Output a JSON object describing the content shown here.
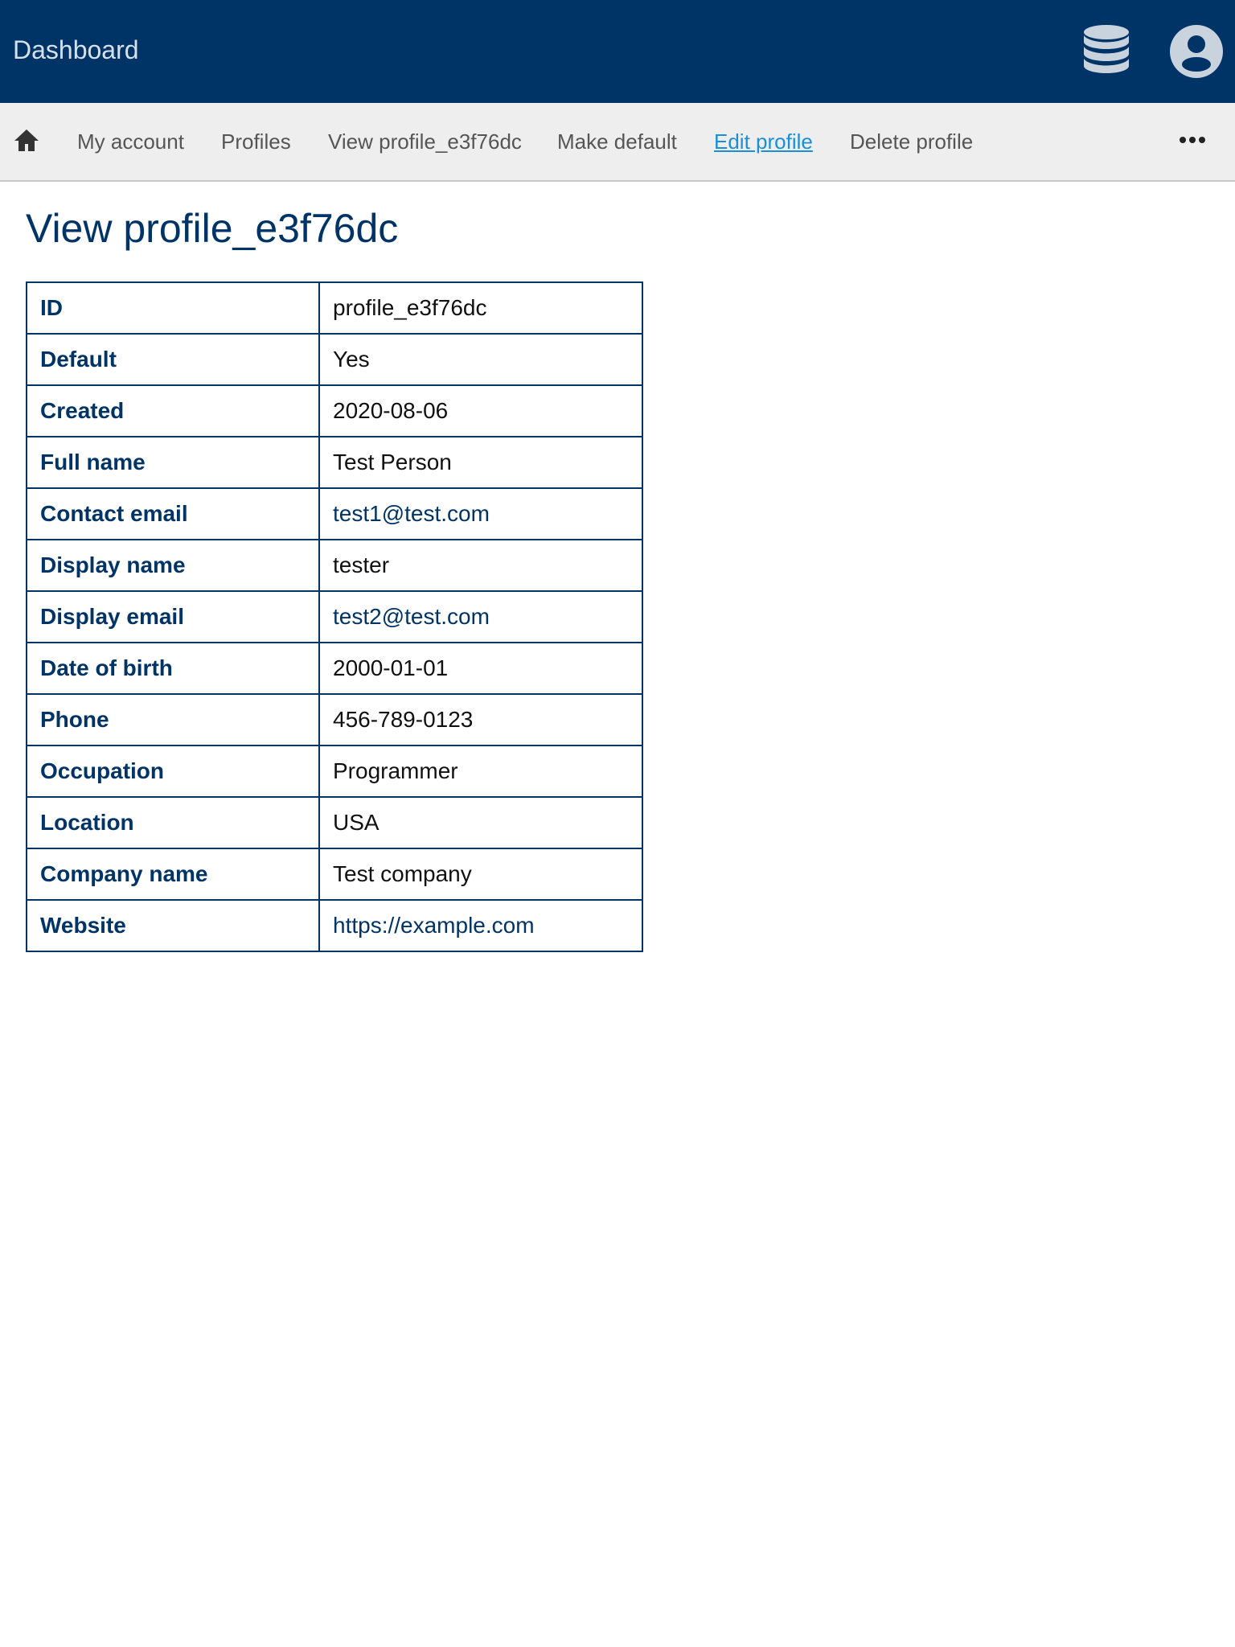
{
  "header": {
    "title": "Dashboard",
    "db_icon": "database-icon",
    "user_icon": "user-account-icon",
    "color": "#003366"
  },
  "nav": {
    "home_icon": "home-icon",
    "items": [
      {
        "label": "My account"
      },
      {
        "label": "Profiles"
      },
      {
        "label": "View profile_e3f76dc"
      },
      {
        "label": "Make default"
      },
      {
        "label": "Edit profile"
      },
      {
        "label": "Delete profile"
      }
    ],
    "more_icon": "more-horizontal-icon",
    "active_color": "#1a8fd6"
  },
  "page": {
    "title": "View profile_e3f76dc"
  },
  "profile": {
    "rows": [
      {
        "label": "ID",
        "value": "profile_e3f76dc"
      },
      {
        "label": "Default",
        "value": "Yes"
      },
      {
        "label": "Created",
        "value": "2020-08-06"
      },
      {
        "label": "Full name",
        "value": "Test Person"
      },
      {
        "label": "Contact email",
        "value": "test1@test.com"
      },
      {
        "label": "Display name",
        "value": "tester"
      },
      {
        "label": "Display email",
        "value": "test2@test.com"
      },
      {
        "label": "Date of birth",
        "value": "2000-01-01"
      },
      {
        "label": "Phone",
        "value": "456-789-0123"
      },
      {
        "label": "Occupation",
        "value": "Programmer"
      },
      {
        "label": "Location",
        "value": "USA"
      },
      {
        "label": "Company name",
        "value": "Test company"
      },
      {
        "label": "Website",
        "value": "https://example.com"
      }
    ]
  }
}
